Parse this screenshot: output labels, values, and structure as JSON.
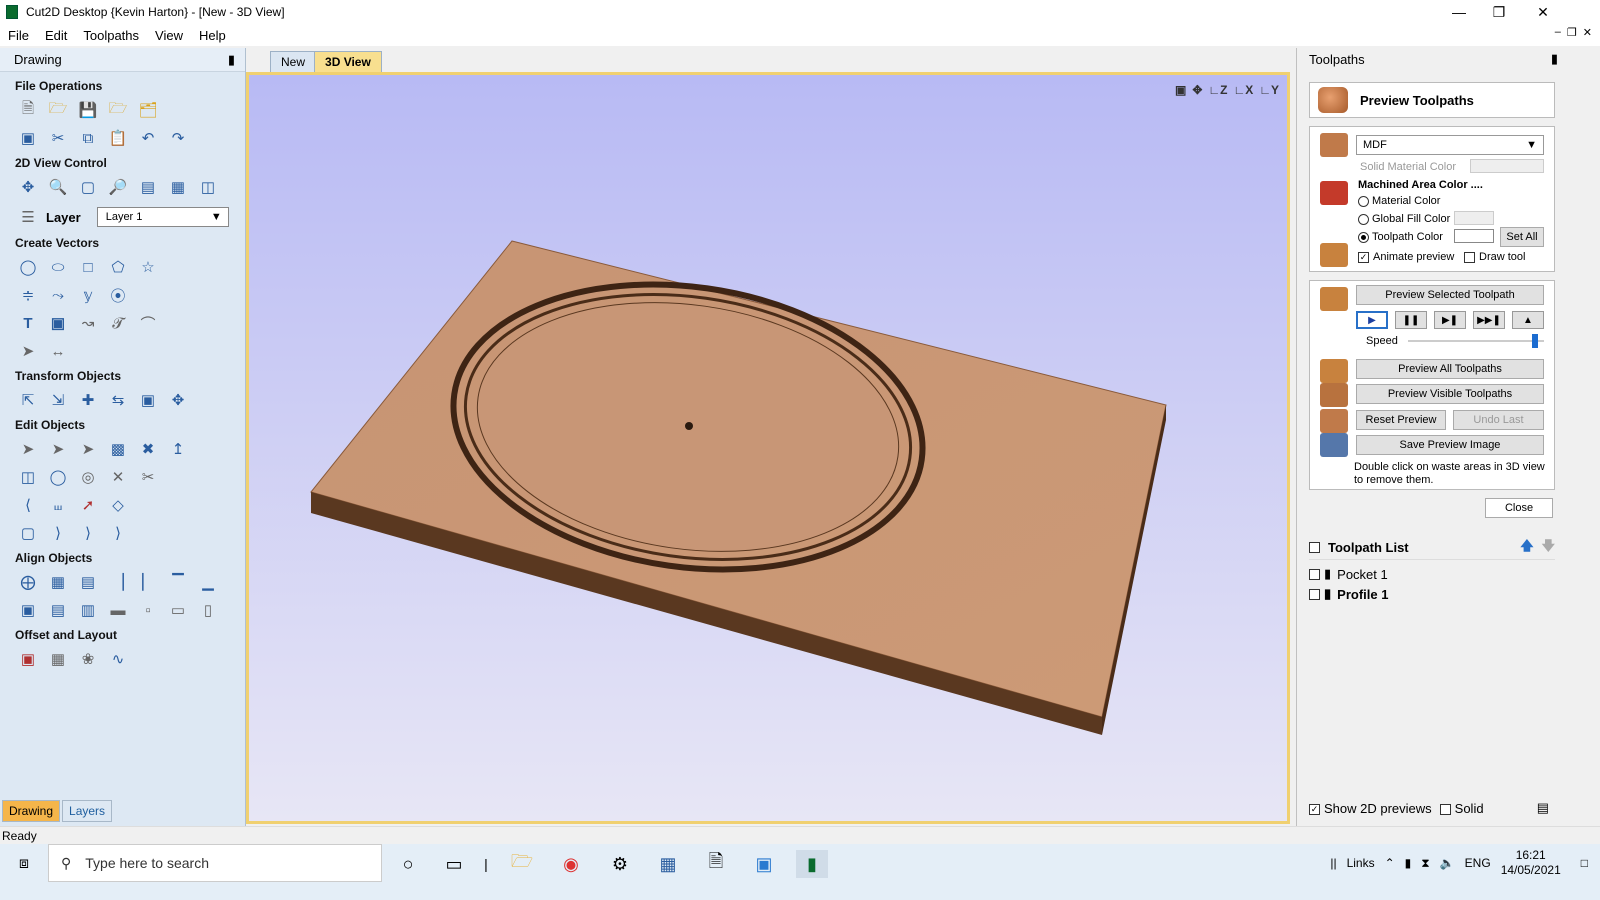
{
  "window": {
    "title": "Cut2D Desktop {Kevin Harton} - [New - 3D View]"
  },
  "menu": [
    "File",
    "Edit",
    "Toolpaths",
    "View",
    "Help"
  ],
  "left_panel": {
    "title": "Drawing",
    "sections": {
      "file_ops": "File Operations",
      "view_ctrl": "2D View Control",
      "create_vectors": "Create Vectors",
      "transform": "Transform Objects",
      "edit": "Edit Objects",
      "align": "Align Objects",
      "offset": "Offset and Layout"
    },
    "layer_label": "Layer",
    "layer_value": "Layer 1",
    "tabs": [
      "Drawing",
      "Layers"
    ]
  },
  "doc_tabs": [
    "New",
    "3D View"
  ],
  "right_panel": {
    "title": "Toolpaths",
    "heading": "Preview Toolpaths",
    "material": "MDF",
    "solid_material_color": "Solid Material Color",
    "machined_area_color": "Machined Area Color ....",
    "opt_material_color": "Material Color",
    "opt_global_fill": "Global Fill Color",
    "opt_toolpath_color": "Toolpath Color",
    "set_all": "Set All",
    "animate_preview": "Animate preview",
    "draw_tool": "Draw tool",
    "preview_selected": "Preview Selected Toolpath",
    "speed": "Speed",
    "speed_level": 0.95,
    "preview_all": "Preview All Toolpaths",
    "preview_visible": "Preview Visible Toolpaths",
    "reset_preview": "Reset Preview",
    "undo_last": "Undo Last",
    "save_image": "Save Preview Image",
    "hint": "Double click on waste areas in 3D view to remove them.",
    "close": "Close",
    "toolpath_list_title": "Toolpath List",
    "toolpaths": [
      "Pocket 1",
      "Profile 1"
    ],
    "show_2d": "Show 2D previews",
    "solid": "Solid"
  },
  "status": "Ready",
  "taskbar": {
    "search_placeholder": "Type here to search",
    "links": "Links",
    "lang": "ENG",
    "time": "16:21",
    "date": "14/05/2021"
  },
  "colors": {
    "accent": "#f5b54a",
    "viewport_top": "#b8baf4",
    "wood": "#c69270"
  }
}
